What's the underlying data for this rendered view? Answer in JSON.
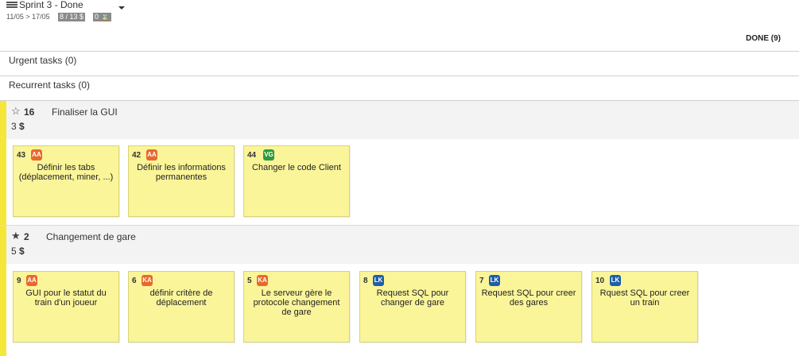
{
  "header": {
    "sprint_title": "Sprint 3 - Done",
    "dates": "11/05 > 17/05",
    "points_pill": "8 / 13 $",
    "hours_pill": "0 ⌛"
  },
  "column": {
    "title": "DONE (9)"
  },
  "sections": {
    "urgent": "Urgent tasks (0)",
    "recurrent": "Recurrent tasks (0)"
  },
  "stories": [
    {
      "number": "16",
      "title": "Finaliser la GUI",
      "points": "3",
      "currency": "$",
      "star": "outline",
      "tasks": [
        {
          "number": "43",
          "assignee": "AA",
          "color": "#e8692d",
          "text": "Définir les tabs (déplacement, miner, ...)"
        },
        {
          "number": "42",
          "assignee": "AA",
          "color": "#e8692d",
          "text": "Définir les informations permanentes"
        },
        {
          "number": "44",
          "assignee": "VG",
          "color": "#2e9b3a",
          "text": "Changer le code Client"
        }
      ]
    },
    {
      "number": "2",
      "title": "Changement de gare",
      "points": "5",
      "currency": "$",
      "star": "filled",
      "tasks": [
        {
          "number": "9",
          "assignee": "AA",
          "color": "#e8692d",
          "text": "GUI pour le statut du train d'un joueur"
        },
        {
          "number": "6",
          "assignee": "KA",
          "color": "#e8692d",
          "text": "définir critère de déplacement"
        },
        {
          "number": "5",
          "assignee": "KA",
          "color": "#e8692d",
          "text": "Le serveur gère le protocole changement de gare"
        },
        {
          "number": "8",
          "assignee": "LK",
          "color": "#1f5fa8",
          "text": "Request SQL pour changer de gare"
        },
        {
          "number": "7",
          "assignee": "LK",
          "color": "#1f5fa8",
          "text": "Request SQL pour creer des gares"
        },
        {
          "number": "10",
          "assignee": "LK",
          "color": "#1f5fa8",
          "text": "Rquest SQL pour creer un train"
        }
      ]
    }
  ]
}
